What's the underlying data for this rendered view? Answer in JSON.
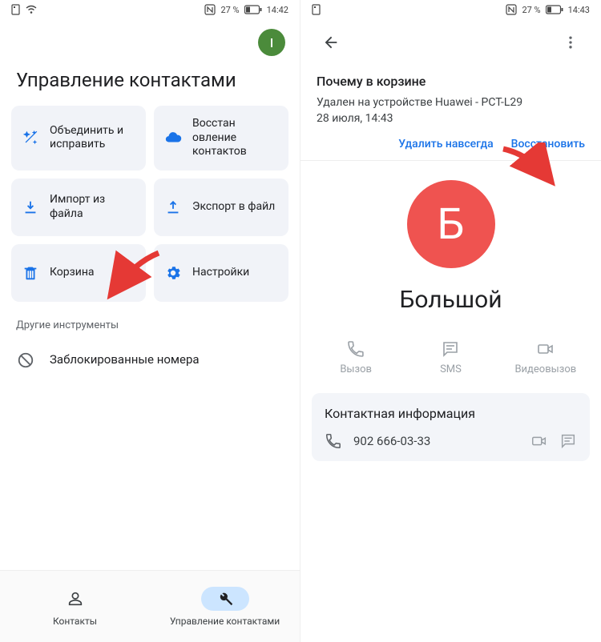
{
  "left": {
    "status": {
      "battery": "27 %",
      "time": "14:42"
    },
    "avatar_initial": "I",
    "title": "Управление контактами",
    "tiles": {
      "merge": "Объединить и исправить",
      "restore": "Восстан овление контактов",
      "import": "Импорт из файла",
      "export": "Экспорт в файл",
      "trash": "Корзина",
      "settings": "Настройки"
    },
    "section_other": "Другие инструменты",
    "blocked": "Заблокированные номера",
    "nav": {
      "contacts": "Контакты",
      "manage": "Управление контактами"
    }
  },
  "right": {
    "status": {
      "battery": "27 %",
      "time": "14:43"
    },
    "trash": {
      "title": "Почему в корзине",
      "line1": "Удален на устройстве Huawei - PCT-L29",
      "line2": "28 июля, 14:43",
      "delete": "Удалить навсегда",
      "restore": "Восстановить"
    },
    "contact": {
      "initial": "Б",
      "name": "Большой",
      "actions": {
        "call": "Вызов",
        "sms": "SMS",
        "video": "Видеовызов"
      },
      "info_title": "Контактная информация",
      "phone": "902 666-03-33"
    }
  }
}
